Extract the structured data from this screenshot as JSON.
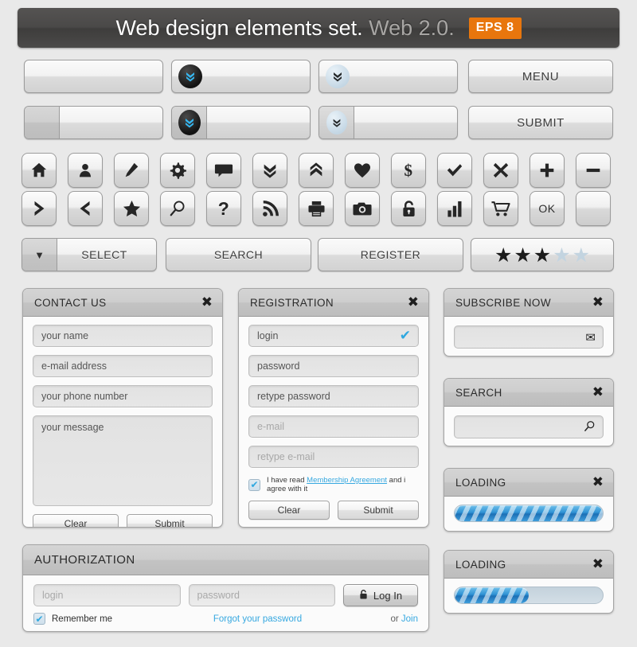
{
  "banner": {
    "title_strong": "Web design elements set.",
    "title_dim": "Web 2.0.",
    "badge": "EPS 8"
  },
  "button_rows": {
    "row1": [
      {
        "name": "plain-button",
        "label": ""
      },
      {
        "name": "dropdown-dark-button",
        "label": "",
        "icon": "double-chevron-down-icon"
      },
      {
        "name": "dropdown-light-button",
        "label": "",
        "icon": "double-chevron-down-icon"
      },
      {
        "name": "menu-button",
        "label": "MENU"
      }
    ],
    "row2": [
      {
        "name": "split-plain-button",
        "label": ""
      },
      {
        "name": "split-dark-button",
        "label": "",
        "icon": "double-chevron-down-icon"
      },
      {
        "name": "split-light-button",
        "label": "",
        "icon": "double-chevron-down-icon"
      },
      {
        "name": "submit-button",
        "label": "SUBMIT"
      }
    ]
  },
  "icons": {
    "row1": [
      "home-icon",
      "user-icon",
      "pencil-icon",
      "gear-icon",
      "comment-icon",
      "chevron-double-down-icon",
      "chevron-double-up-icon",
      "heart-icon",
      "dollar-icon",
      "check-icon",
      "close-x-icon",
      "plus-icon",
      "minus-icon"
    ],
    "row2": [
      "arrow-right-icon",
      "arrow-left-icon",
      "star-icon",
      "magnifier-icon",
      "question-icon",
      "rss-icon",
      "printer-icon",
      "camera-icon",
      "lock-icon",
      "bar-chart-icon",
      "cart-icon",
      "ok-icon",
      "blank-icon"
    ],
    "ok_label": "OK"
  },
  "action_row": {
    "select_label": "SELECT",
    "select_arrow": "▼",
    "search_label": "SEARCH",
    "register_label": "REGISTER",
    "rating": {
      "filled": 3,
      "total": 5,
      "star_glyph": "★"
    }
  },
  "contact_panel": {
    "title": "CONTACT US",
    "close": "✖",
    "fields": [
      {
        "name": "name-field",
        "placeholder": "your name"
      },
      {
        "name": "email-field",
        "placeholder": "e-mail address"
      },
      {
        "name": "phone-field",
        "placeholder": "your phone number"
      },
      {
        "name": "message-field",
        "placeholder": "your message"
      }
    ],
    "clear_label": "Clear",
    "submit_label": "Submit"
  },
  "registration_panel": {
    "title": "REGISTRATION",
    "close": "✖",
    "fields": [
      {
        "name": "login-field",
        "placeholder": "login",
        "valid": true,
        "pale": false
      },
      {
        "name": "password-field",
        "placeholder": "password",
        "valid": false,
        "pale": false
      },
      {
        "name": "retype-password-field",
        "placeholder": "retype password",
        "valid": false,
        "pale": false
      },
      {
        "name": "email-field",
        "placeholder": "e-mail",
        "valid": false,
        "pale": true
      },
      {
        "name": "retype-email-field",
        "placeholder": "retype e-mail",
        "valid": false,
        "pale": true
      }
    ],
    "check_glyph": "✔",
    "agree_prefix": "I have read ",
    "agree_link": "Membership Agreement",
    "agree_suffix": " and i agree with it",
    "clear_label": "Clear",
    "submit_label": "Submit"
  },
  "subscribe_panel": {
    "title": "SUBSCRIBE NOW",
    "close": "✖",
    "field_placeholder": "",
    "icon": "envelope-icon",
    "icon_glyph": "✉"
  },
  "search_panel": {
    "title": "SEARCH",
    "close": "✖",
    "field_placeholder": "",
    "icon": "magnifier-icon"
  },
  "loading_panels": [
    {
      "title": "LOADING",
      "close": "✖",
      "percent": 100
    },
    {
      "title": "LOADING",
      "close": "✖",
      "percent": 50
    }
  ],
  "authorization_panel": {
    "title": "AUTHORIZATION",
    "login_placeholder": "login",
    "password_placeholder": "password",
    "login_button_label": "Log In",
    "lock_icon": "lock-icon",
    "remember_label": "Remember me",
    "remember_checked": true,
    "check_glyph": "✔",
    "forgot_label": "Forgot your password",
    "or_label": "or ",
    "join_label": "Join"
  },
  "colors": {
    "accent_orange": "#e8760d",
    "accent_blue": "#36a8e0",
    "progress_blue": "#2f92d4",
    "page_bg": "#e9e9e9"
  }
}
